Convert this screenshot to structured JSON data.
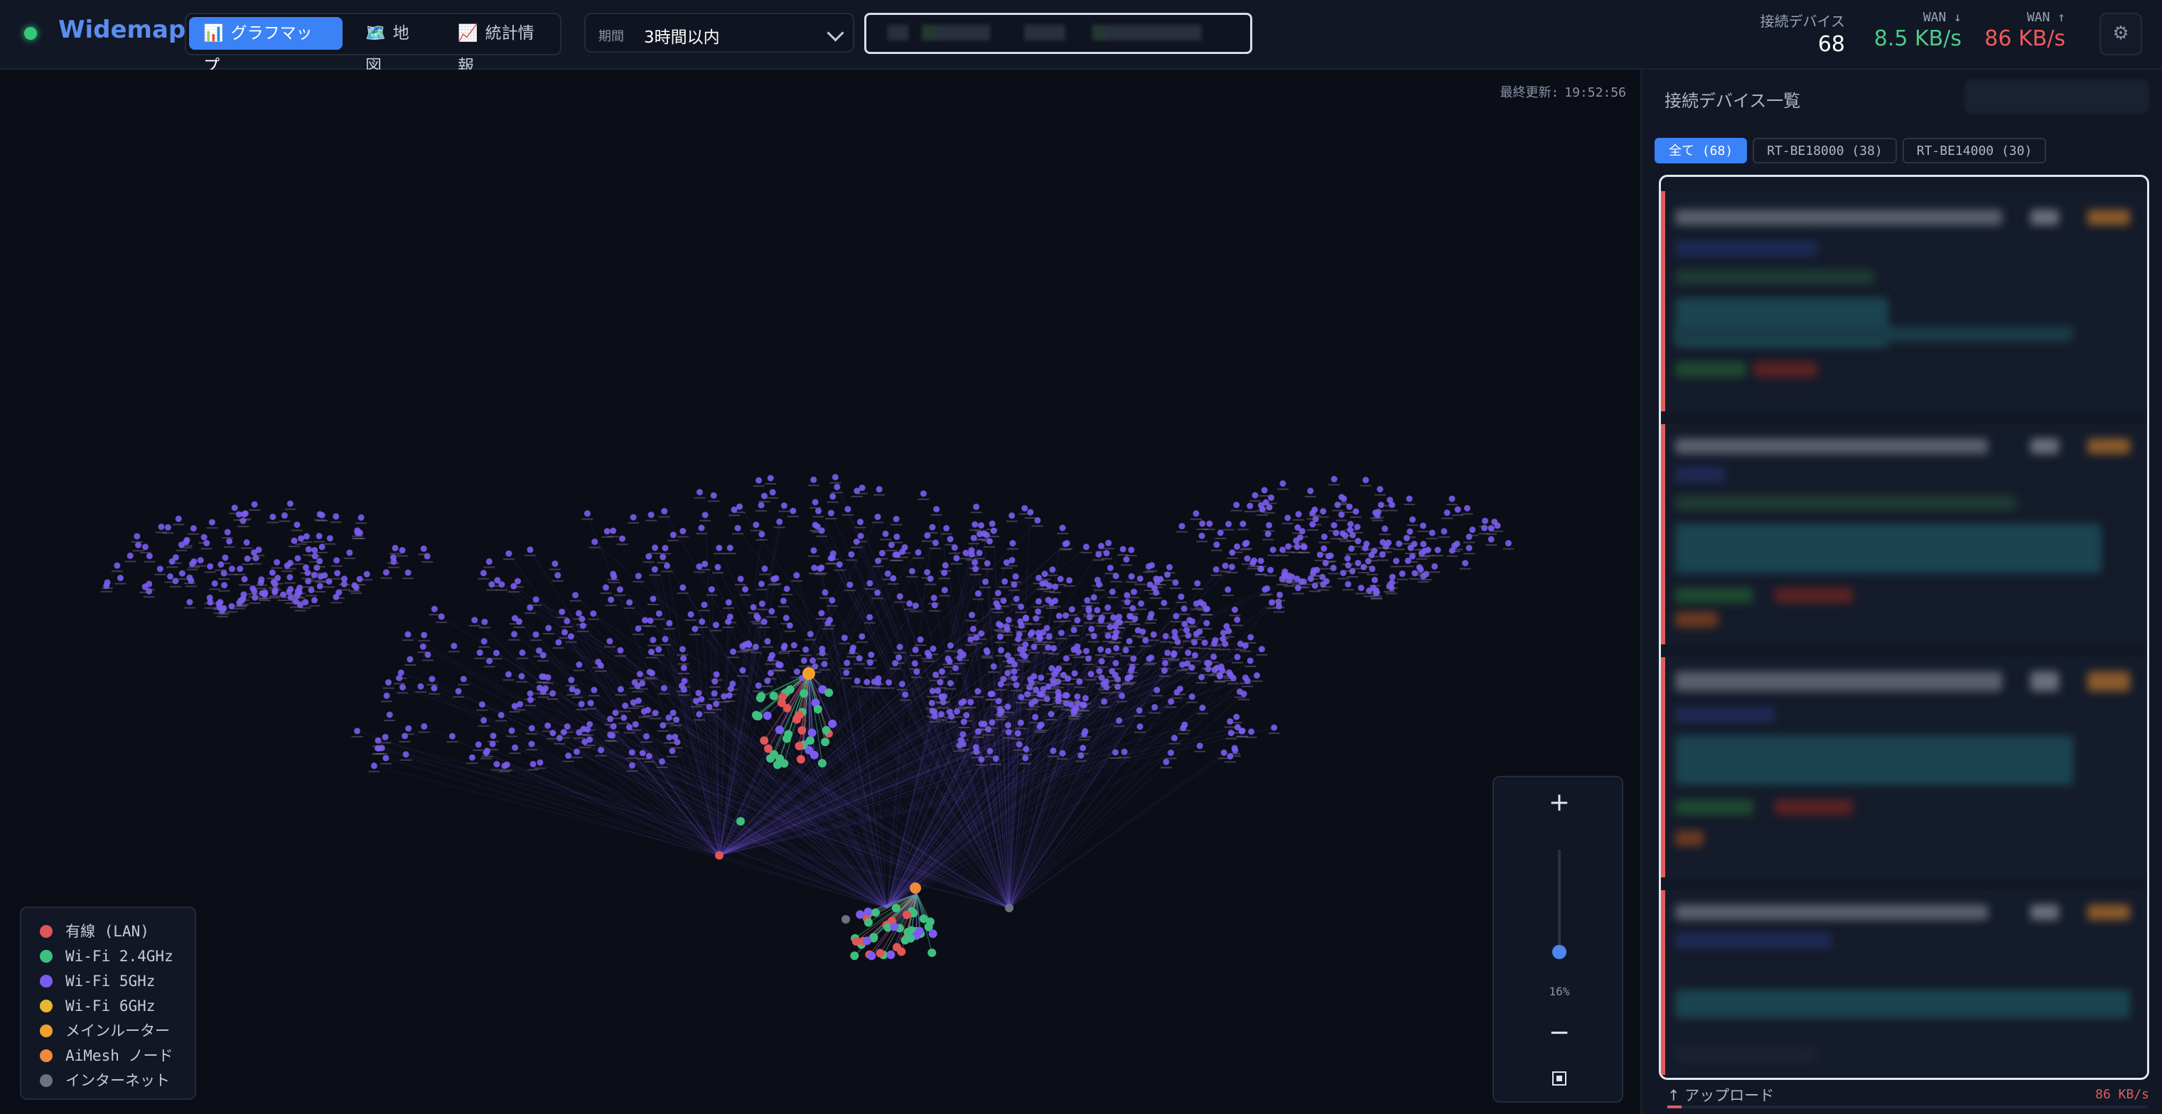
{
  "app": {
    "name": "Widemap"
  },
  "nav": {
    "tabs": [
      {
        "icon": "📊",
        "label": "グラフマップ",
        "active": true
      },
      {
        "icon": "🗺️",
        "label": "地図",
        "active": false
      },
      {
        "icon": "📈",
        "label": "統計情報",
        "active": false
      }
    ]
  },
  "period": {
    "label": "期間",
    "value": "3時間以内"
  },
  "stats": {
    "devices": {
      "label": "接続デバイス",
      "value": "68"
    },
    "wan_down": {
      "label": "WAN ↓",
      "value": "8.5 KB/s",
      "color": "#4ec98a"
    },
    "wan_up": {
      "label": "WAN ↑",
      "value": "86 KB/s",
      "color": "#f05a5a"
    }
  },
  "settings": {
    "icon": "gear-icon",
    "glyph": "⚙"
  },
  "map": {
    "last_update_label": "最終更新:",
    "last_update_time": "19:52:56",
    "zoom": {
      "in": "+",
      "out": "−",
      "level": "16%",
      "level_fraction": 0.16
    }
  },
  "legend": {
    "items": [
      {
        "label": "有線 (LAN)",
        "color": "#e05555"
      },
      {
        "label": "Wi-Fi 2.4GHz",
        "color": "#3fbf7f"
      },
      {
        "label": "Wi-Fi 5GHz",
        "color": "#7b5cf0"
      },
      {
        "label": "Wi-Fi 6GHz",
        "color": "#e8b62f"
      },
      {
        "label": "メインルーター",
        "color": "#f0a030"
      },
      {
        "label": "AiMesh ノード",
        "color": "#ee8a3a"
      },
      {
        "label": "インターネット",
        "color": "#6b7280"
      }
    ]
  },
  "panel": {
    "title": "接続デバイス一覧",
    "filters": [
      {
        "label": "全て (68)",
        "active": true
      },
      {
        "label": "RT-BE18000 (38)",
        "active": false
      },
      {
        "label": "RT-BE14000 (30)",
        "active": false
      }
    ],
    "upload_label": "↑ アップロード",
    "upload_value": "86 KB/s",
    "upload_fraction": 0.03
  }
}
